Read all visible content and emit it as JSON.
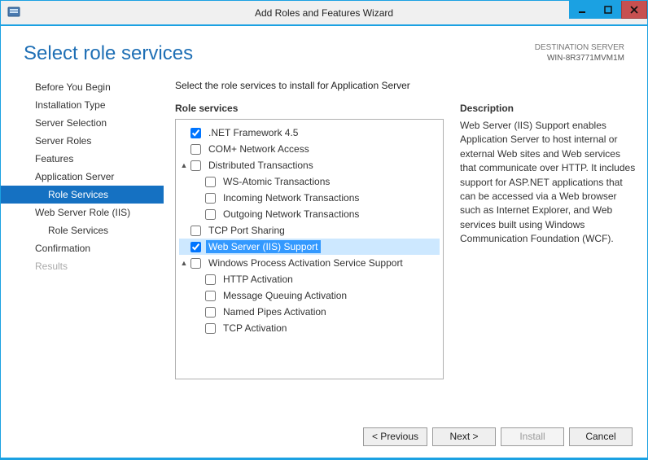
{
  "window": {
    "title": "Add Roles and Features Wizard"
  },
  "header": {
    "heading": "Select role services",
    "destination_label": "DESTINATION SERVER",
    "destination_value": "WIN-8R3771MVM1M"
  },
  "nav": {
    "items": [
      {
        "label": "Before You Begin",
        "sub": false,
        "selected": false,
        "disabled": false
      },
      {
        "label": "Installation Type",
        "sub": false,
        "selected": false,
        "disabled": false
      },
      {
        "label": "Server Selection",
        "sub": false,
        "selected": false,
        "disabled": false
      },
      {
        "label": "Server Roles",
        "sub": false,
        "selected": false,
        "disabled": false
      },
      {
        "label": "Features",
        "sub": false,
        "selected": false,
        "disabled": false
      },
      {
        "label": "Application Server",
        "sub": false,
        "selected": false,
        "disabled": false
      },
      {
        "label": "Role Services",
        "sub": true,
        "selected": true,
        "disabled": false
      },
      {
        "label": "Web Server Role (IIS)",
        "sub": false,
        "selected": false,
        "disabled": false
      },
      {
        "label": "Role Services",
        "sub": true,
        "selected": false,
        "disabled": false
      },
      {
        "label": "Confirmation",
        "sub": false,
        "selected": false,
        "disabled": false
      },
      {
        "label": "Results",
        "sub": false,
        "selected": false,
        "disabled": true
      }
    ]
  },
  "main": {
    "intro": "Select the role services to install for Application Server",
    "role_services_title": "Role services",
    "description_title": "Description",
    "description_text": "Web Server (IIS) Support enables Application Server to host internal or external Web sites and Web services that communicate over HTTP. It includes support for ASP.NET applications that can be accessed via a Web browser such as Internet Explorer, and Web services built using Windows Communication Foundation (WCF).",
    "tree": [
      {
        "indent": 0,
        "expander": "",
        "checked": true,
        "label": ".NET Framework 4.5",
        "selected": false
      },
      {
        "indent": 0,
        "expander": "",
        "checked": false,
        "label": "COM+ Network Access",
        "selected": false
      },
      {
        "indent": 0,
        "expander": "▲",
        "checked": false,
        "label": "Distributed Transactions",
        "selected": false
      },
      {
        "indent": 1,
        "expander": "",
        "checked": false,
        "label": "WS-Atomic Transactions",
        "selected": false
      },
      {
        "indent": 1,
        "expander": "",
        "checked": false,
        "label": "Incoming Network Transactions",
        "selected": false
      },
      {
        "indent": 1,
        "expander": "",
        "checked": false,
        "label": "Outgoing Network Transactions",
        "selected": false
      },
      {
        "indent": 0,
        "expander": "",
        "checked": false,
        "label": "TCP Port Sharing",
        "selected": false
      },
      {
        "indent": 0,
        "expander": "",
        "checked": true,
        "label": "Web Server (IIS) Support",
        "selected": true
      },
      {
        "indent": 0,
        "expander": "▲",
        "checked": false,
        "label": "Windows Process Activation Service Support",
        "selected": false
      },
      {
        "indent": 1,
        "expander": "",
        "checked": false,
        "label": "HTTP Activation",
        "selected": false
      },
      {
        "indent": 1,
        "expander": "",
        "checked": false,
        "label": "Message Queuing Activation",
        "selected": false
      },
      {
        "indent": 1,
        "expander": "",
        "checked": false,
        "label": "Named Pipes Activation",
        "selected": false
      },
      {
        "indent": 1,
        "expander": "",
        "checked": false,
        "label": "TCP Activation",
        "selected": false
      }
    ]
  },
  "footer": {
    "previous": "< Previous",
    "next": "Next >",
    "install": "Install",
    "cancel": "Cancel"
  }
}
